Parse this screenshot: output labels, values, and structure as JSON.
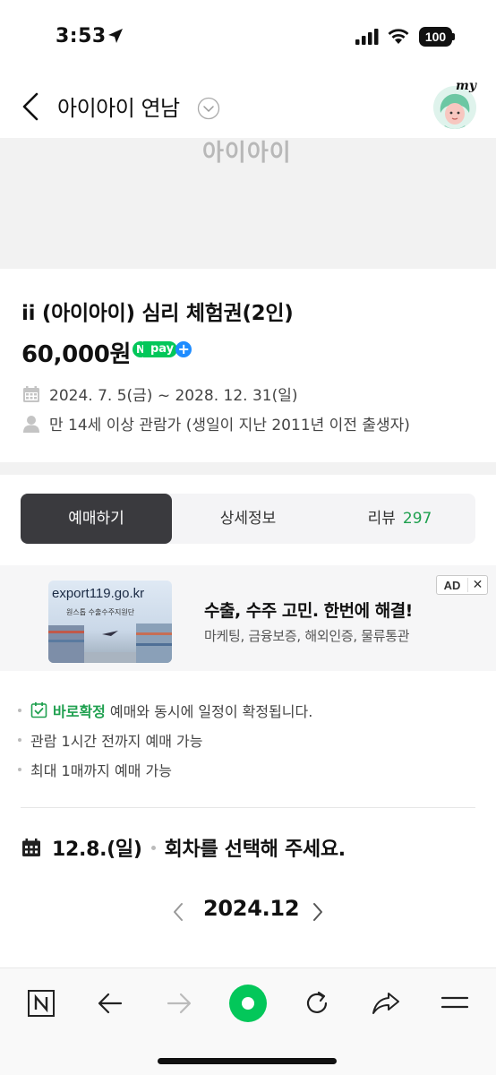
{
  "status_bar": {
    "time": "3:53",
    "battery": "100"
  },
  "header": {
    "title": "아이아이 연남",
    "avatar_label": "my"
  },
  "hero": {
    "logo_text": "아이아이"
  },
  "product": {
    "title": "ii (아이아이) 심리 체험권(2인)",
    "price": "60,000원",
    "npay": {
      "n": "N",
      "pay": "pay",
      "plus": "+"
    },
    "period": "2024. 7. 5(금) ~ 2028. 12. 31(일)",
    "age": "만 14세 이상 관람가 (생일이 지난 2011년 이전 출생자)"
  },
  "tabs": [
    {
      "label": "예매하기",
      "active": true
    },
    {
      "label": "상세정보"
    },
    {
      "label": "리뷰",
      "count": "297"
    }
  ],
  "ad": {
    "thumb_url": "export119.go.kr",
    "thumb_sub": "원스톱 수출수주지원단",
    "headline": "수출, 수주 고민. 한번에 해결!",
    "description": "마케팅, 금융보증, 해외인증, 물류통관",
    "badge": "AD",
    "close": "✕"
  },
  "notes": {
    "confirm_label": "바로확정",
    "confirm_text": "예매와 동시에 일정이 확정됩니다.",
    "line2": "관람 1시간 전까지 예매 가능",
    "line3": "최대 1매까지 예매 가능"
  },
  "date_select": {
    "date": "12.8.(일)",
    "prompt": "회차를 선택해 주세요."
  },
  "month_nav": {
    "label": "2024.12"
  },
  "colors": {
    "accent_green": "#1fa04f",
    "naver_green": "#03c75a",
    "tab_active": "#3a3a3e"
  }
}
